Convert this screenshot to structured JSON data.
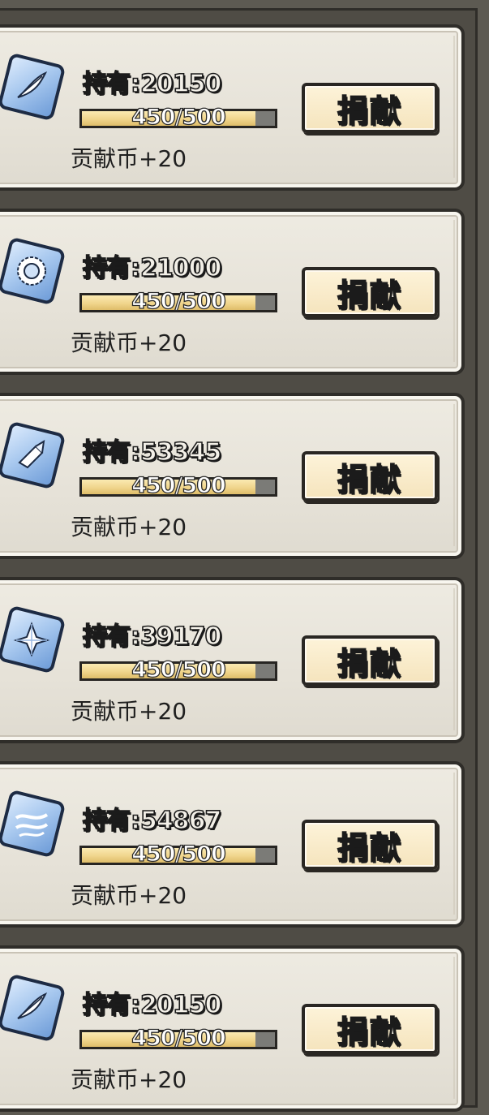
{
  "rows": [
    {
      "icon": "feather-icon",
      "hold_label": "持有",
      "hold_count": "20150",
      "progress_text": "450/500",
      "progress": 0.9,
      "reward_text": "贡献币+20",
      "button_label": "捐献"
    },
    {
      "icon": "gear-icon",
      "hold_label": "持有",
      "hold_count": "21000",
      "progress_text": "450/500",
      "progress": 0.9,
      "reward_text": "贡献币+20",
      "button_label": "捐献"
    },
    {
      "icon": "shard-icon",
      "hold_label": "持有",
      "hold_count": "53345",
      "progress_text": "450/500",
      "progress": 0.9,
      "reward_text": "贡献币+20",
      "button_label": "捐献"
    },
    {
      "icon": "crystal-icon",
      "hold_label": "持有",
      "hold_count": "39170",
      "progress_text": "450/500",
      "progress": 0.9,
      "reward_text": "贡献币+20",
      "button_label": "捐献"
    },
    {
      "icon": "wind-icon",
      "hold_label": "持有",
      "hold_count": "54867",
      "progress_text": "450/500",
      "progress": 0.9,
      "reward_text": "贡献币+20",
      "button_label": "捐献"
    },
    {
      "icon": "feather-icon",
      "hold_label": "持有",
      "hold_count": "20150",
      "progress_text": "450/500",
      "progress": 0.9,
      "reward_text": "贡献币+20",
      "button_label": "捐献"
    }
  ],
  "colors": {
    "accent_bar": "#f0d58c",
    "button_bg": "#f5e4bd",
    "card_bg": "#e6e2d8"
  }
}
